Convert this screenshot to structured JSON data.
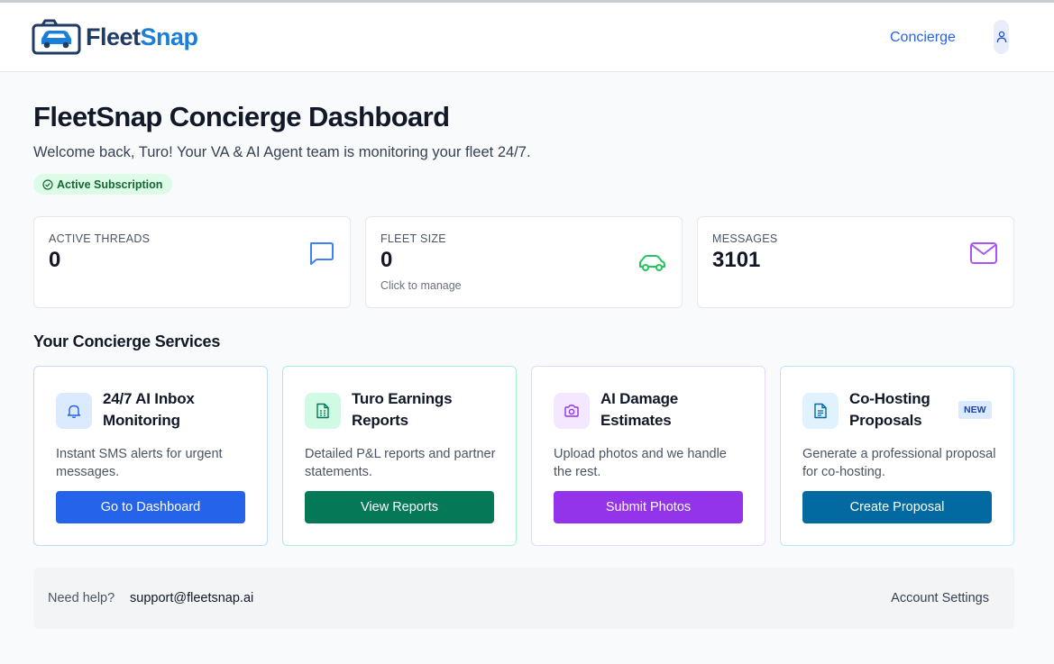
{
  "brand": {
    "name_part1": "Fleet",
    "name_part2": "Snap"
  },
  "nav": {
    "concierge_link": "Concierge"
  },
  "page": {
    "title": "FleetSnap Concierge Dashboard",
    "welcome": "Welcome back, Turo! Your VA & AI Agent team is monitoring your fleet 24/7.",
    "subscription_badge": "Active Subscription"
  },
  "stats": [
    {
      "label": "ACTIVE THREADS",
      "value": "0",
      "icon": "chat-bubble-icon",
      "color": "#3b82f6"
    },
    {
      "label": "FLEET SIZE",
      "value": "0",
      "sub": "Click to manage",
      "icon": "car-icon",
      "color": "#22c55e"
    },
    {
      "label": "MESSAGES",
      "value": "3101",
      "icon": "envelope-icon",
      "color": "#a855f7"
    }
  ],
  "services_heading": "Your Concierge Services",
  "services": [
    {
      "title": "24/7 AI Inbox Monitoring",
      "desc": "Instant SMS alerts for urgent messages.",
      "button": "Go to Dashboard",
      "icon": "bell-icon",
      "color": "#2563eb"
    },
    {
      "title": "Turo Earnings Reports",
      "desc": "Detailed P&L reports and partner statements.",
      "button": "View Reports",
      "icon": "spreadsheet-icon",
      "color": "#047857"
    },
    {
      "title": "AI Damage Estimates",
      "desc": "Upload photos and we handle the rest.",
      "button": "Submit Photos",
      "icon": "camera-icon",
      "color": "#9333ea"
    },
    {
      "title": "Co-Hosting Proposals",
      "desc": "Generate a professional proposal for co-hosting.",
      "button": "Create Proposal",
      "badge": "NEW",
      "icon": "document-icon",
      "color": "#0369a1"
    }
  ],
  "footer": {
    "help_label": "Need help?",
    "email": "support@fleetsnap.ai",
    "account_settings": "Account Settings"
  }
}
